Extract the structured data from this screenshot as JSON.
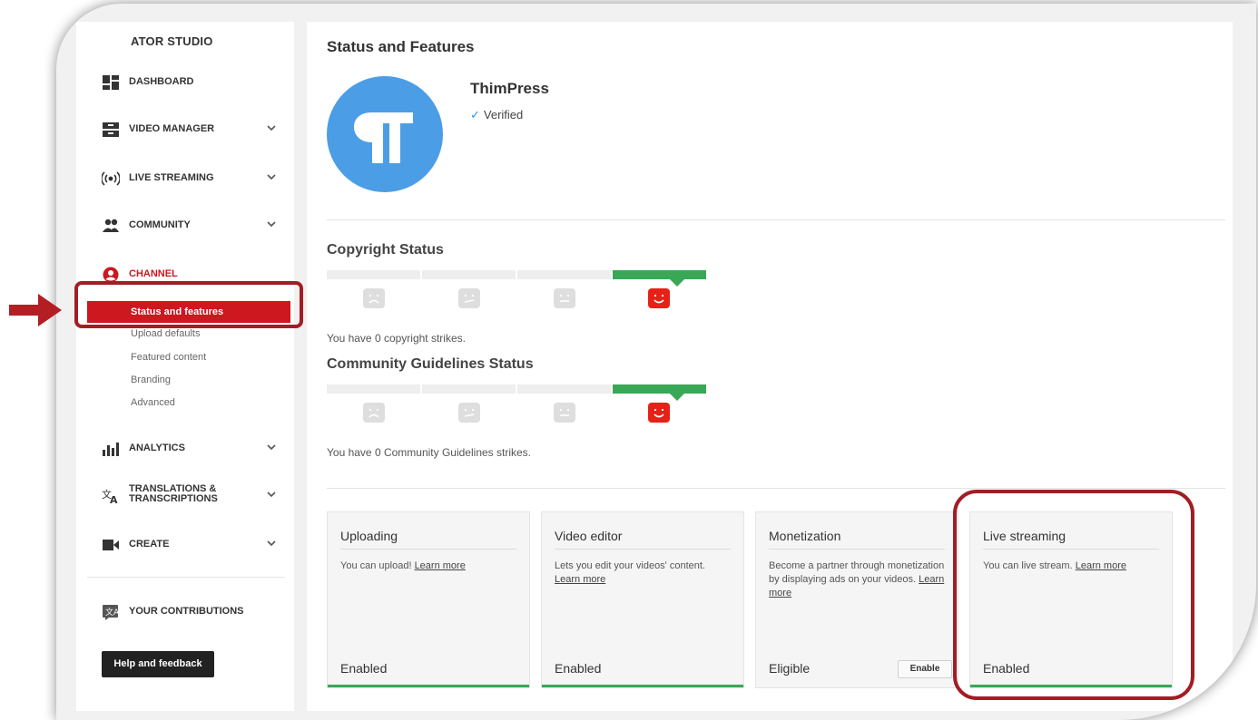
{
  "sidebar": {
    "title": "ATOR STUDIO",
    "items": [
      {
        "label": "DASHBOARD",
        "icon": "dashboard-icon"
      },
      {
        "label": "VIDEO MANAGER",
        "icon": "video-manager-icon"
      },
      {
        "label": "LIVE STREAMING",
        "icon": "live-streaming-icon"
      },
      {
        "label": "COMMUNITY",
        "icon": "community-icon"
      },
      {
        "label": "CHANNEL",
        "icon": "channel-icon"
      },
      {
        "label": "ANALYTICS",
        "icon": "analytics-icon"
      },
      {
        "label": "TRANSLATIONS & TRANSCRIPTIONS",
        "icon": "translate-icon"
      },
      {
        "label": "CREATE",
        "icon": "video-camera-icon"
      },
      {
        "label": "YOUR CONTRIBUTIONS",
        "icon": "contributions-icon"
      }
    ],
    "channel_subitems": [
      "Status and features",
      "Upload defaults",
      "Featured content",
      "Branding",
      "Advanced"
    ],
    "help_button": "Help and feedback"
  },
  "main": {
    "heading": "Status and Features",
    "channel_name": "ThimPress",
    "verified": "Verified",
    "copyright_title": "Copyright Status",
    "copyright_strikes": "You have 0 copyright strikes.",
    "community_title": "Community Guidelines Status",
    "community_strikes": "You have 0 Community Guidelines strikes.",
    "cards": [
      {
        "title": "Uploading",
        "desc": "You can upload!",
        "link": "Learn more",
        "status": "Enabled"
      },
      {
        "title": "Video editor",
        "desc": "Lets you edit your videos' content.",
        "link": "Learn more",
        "status": "Enabled"
      },
      {
        "title": "Monetization",
        "desc": "Become a partner through monetization by displaying ads on your videos.",
        "link": "Learn more",
        "status": "Eligible",
        "button": "Enable"
      },
      {
        "title": "Live streaming",
        "desc": "You can live stream.",
        "link": "Learn more",
        "status": "Enabled"
      }
    ]
  },
  "colors": {
    "accent_red": "#cc181e",
    "highlight": "#a21d24",
    "status_green": "#3aa757",
    "avatar_blue": "#4b9ee6"
  }
}
